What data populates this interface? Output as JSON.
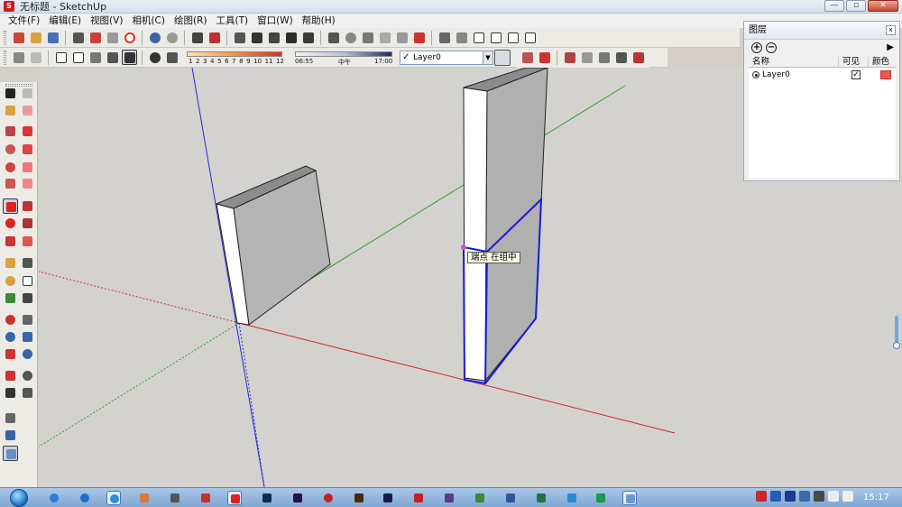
{
  "window": {
    "title": "无标题 - SketchUp",
    "app_icon": "sketchup-logo-icon",
    "buttons": [
      "—",
      "▫",
      "✕"
    ]
  },
  "menu": [
    "文件(F)",
    "编辑(E)",
    "视图(V)",
    "相机(C)",
    "绘图(R)",
    "工具(T)",
    "窗口(W)",
    "帮助(H)"
  ],
  "toolbar_row1_icons": [
    "new-file-icon",
    "open-icon",
    "save-icon",
    "cut-icon",
    "copy-icon",
    "paste-icon",
    "erase-icon",
    "undo-icon",
    "redo-icon",
    "print-icon",
    "model-info-icon",
    "select-group-icon",
    "orbit-icon",
    "pan-icon",
    "zoom-icon",
    "zoom-window-icon",
    "zoom-extents-icon",
    "previous-view-icon",
    "next-view-icon",
    "iso-view-icon",
    "top-view-icon",
    "front-view-icon",
    "right-view-icon",
    "back-view-icon",
    "left-view-icon"
  ],
  "shadow_scale": {
    "ticks": [
      "1",
      "2",
      "3",
      "4",
      "5",
      "6",
      "7",
      "8",
      "9",
      "10",
      "11",
      "12"
    ]
  },
  "time_scale": {
    "start": "06:55",
    "mid": "中午",
    "end": "17:00"
  },
  "layer_dropdown": {
    "value": "Layer0"
  },
  "tooltip": "端点  在组中",
  "layers_panel": {
    "title": "图层",
    "close": "x",
    "add": "+",
    "remove": "−",
    "detail": "▶",
    "columns": [
      "名称",
      "可见",
      "颜色"
    ],
    "rows": [
      {
        "name": "Layer0",
        "visible": "✓",
        "color": "#ee5555"
      }
    ]
  },
  "taskbar": {
    "time": "15:17",
    "icons": [
      "ie-icon",
      "qq-icon",
      "browser-icon",
      "paint-icon",
      "camera-icon",
      "autocad-icon",
      "sketchup-icon",
      "photoshop-icon",
      "premiere-icon",
      "record-icon",
      "bridge-icon",
      "folder-icon",
      "acrobat-icon",
      "media-icon",
      "image-icon",
      "word-icon",
      "excel-icon",
      "wps-icon",
      "wps-s-icon",
      "explorer-icon"
    ]
  }
}
